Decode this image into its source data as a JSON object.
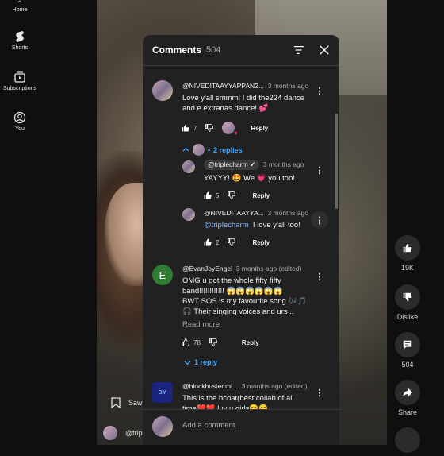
{
  "sidebar": {
    "items": [
      {
        "label": "Home",
        "icon": "home-icon"
      },
      {
        "label": "Shorts",
        "icon": "shorts-icon"
      },
      {
        "label": "Subscriptions",
        "icon": "subscriptions-icon"
      },
      {
        "label": "You",
        "icon": "you-icon"
      }
    ]
  },
  "rail": {
    "like_count": "19K",
    "dislike_label": "Dislike",
    "comment_count": "504",
    "share_label": "Share"
  },
  "overlay": {
    "save_label": "Saw",
    "handle": "@trip"
  },
  "panel": {
    "title": "Comments",
    "count": "504",
    "add_placeholder": "Add a comment..."
  },
  "comments": [
    {
      "author": "@NIVEDITAAYYAPPAN2...",
      "time": "3 months ago",
      "text": "Love y'all smmm! I did the224 dance and e extranas dance! 💕",
      "likes": "7",
      "reply": "Reply",
      "replies_label": "2 replies"
    },
    {
      "author": "@triplecharm ✔",
      "time": "3 months ago",
      "text": "YAYYY! 🤩 We 💗 you too!",
      "likes": "5",
      "reply": "Reply"
    },
    {
      "author": "@NIVEDITAAYYA...",
      "time": "3 months ago",
      "mention": "@triplecharm",
      "text": "I love y'all too!",
      "likes": "2",
      "reply": "Reply"
    },
    {
      "author": "@EvanJoyEngel",
      "time": "3 months ago (edited)",
      "avatar_letter": "E",
      "text_lines": [
        "OMG u got the whole fifty fifty",
        "band!!!!!!!!!!!! 😱😱😱😱😱😱",
        "BWT SOS is my favourite song 🎶🎵",
        "🎧 Their singing voices and urs .."
      ],
      "read_more": "Read more",
      "likes": "78",
      "reply": "Reply",
      "replies_label": "1 reply"
    },
    {
      "author": "@blockbuster.mi...",
      "time": "3 months ago (edited)",
      "avatar_text": "BM",
      "text_lines": [
        "This is the bcoat(best collab of all",
        "time❤️❤️ luv u girls😊😊"
      ]
    }
  ],
  "colors": {
    "panel_bg": "#212121",
    "link_blue": "#3ea6ff",
    "mention_blue": "#8ab4f8"
  }
}
